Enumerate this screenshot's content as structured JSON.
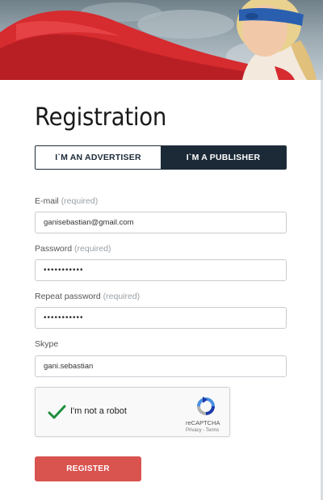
{
  "form": {
    "title": "Registration",
    "tabs": [
      {
        "label": "I`M AN ADVERTISER",
        "active": false
      },
      {
        "label": "I`M A PUBLISHER",
        "active": true
      }
    ],
    "email": {
      "label": "E-mail",
      "required": "(required)",
      "value": "ganisebastian@gmail.com"
    },
    "password": {
      "label": "Password",
      "required": "(required)",
      "value": "•••••••••••"
    },
    "repeat_password": {
      "label": "Repeat password",
      "required": "(required)",
      "value": "•••••••••••"
    },
    "skype": {
      "label": "Skype",
      "value": "gani.sebastian"
    },
    "captcha": {
      "label": "I'm not a robot",
      "brand": "reCAPTCHA",
      "privacy": "Privacy",
      "separator": " - ",
      "terms": "Terms",
      "checked": true
    },
    "register_label": "REGISTER"
  },
  "colors": {
    "accent": "#d9534f",
    "dark_tab": "#1c2a38",
    "check_green": "#1e8e3e",
    "cape_red": "#d62b2f",
    "mask_blue": "#2a5fb0"
  },
  "icons": {
    "check": "checkmark-icon",
    "recaptcha": "recaptcha-logo-icon"
  }
}
